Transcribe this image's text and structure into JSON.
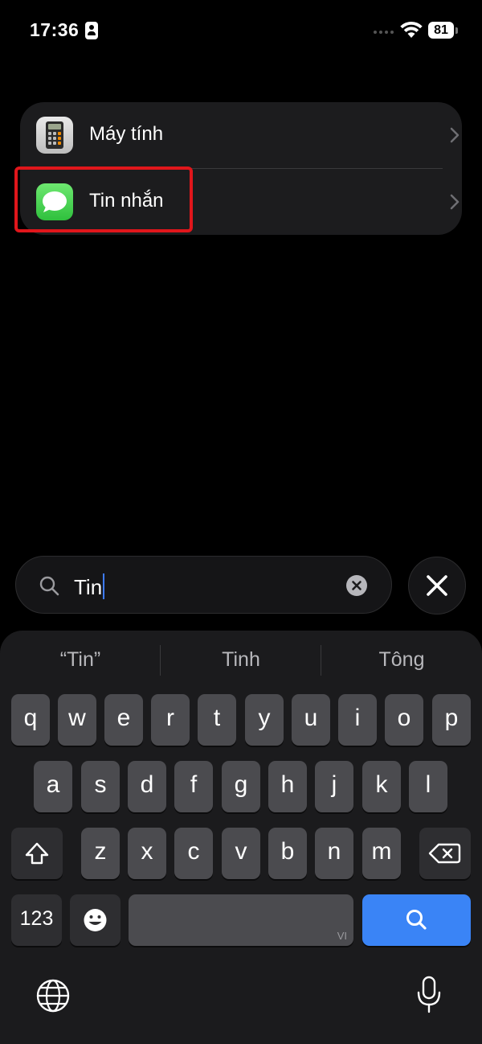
{
  "status_bar": {
    "time": "17:36",
    "battery": "81"
  },
  "results": [
    {
      "label": "Máy tính",
      "icon": "calculator-app-icon"
    },
    {
      "label": "Tin nhắn",
      "icon": "messages-app-icon"
    }
  ],
  "highlight_color": "#e0161b",
  "search": {
    "value": "Tin",
    "placeholder": "Search"
  },
  "keyboard": {
    "suggestions": [
      "“Tin”",
      "Tinh",
      "Tông"
    ],
    "row1": [
      "q",
      "w",
      "e",
      "r",
      "t",
      "y",
      "u",
      "i",
      "o",
      "p"
    ],
    "row2": [
      "a",
      "s",
      "d",
      "f",
      "g",
      "h",
      "j",
      "k",
      "l"
    ],
    "row3": [
      "z",
      "x",
      "c",
      "v",
      "b",
      "n",
      "m"
    ],
    "numbers_label": "123",
    "space_language": "VI",
    "accent_color": "#3a84f6"
  }
}
